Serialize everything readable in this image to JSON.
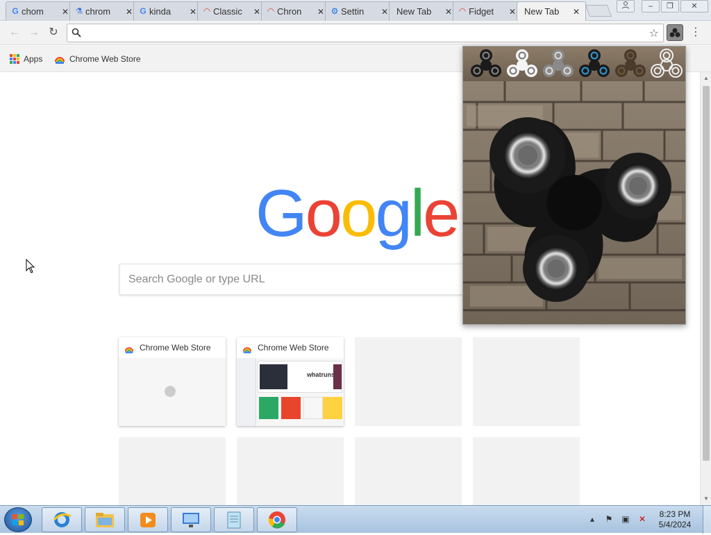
{
  "tabs": [
    {
      "label": "chom",
      "favicon": "google-icon",
      "active": false
    },
    {
      "label": "chrom",
      "favicon": "flask-icon",
      "active": false
    },
    {
      "label": "kinda",
      "favicon": "google-icon",
      "active": false
    },
    {
      "label": "Classic",
      "favicon": "rainbow-icon",
      "active": false
    },
    {
      "label": "Chron",
      "favicon": "rainbow-icon",
      "active": false
    },
    {
      "label": "Settin",
      "favicon": "gear-icon",
      "active": false
    },
    {
      "label": "New Tab",
      "favicon": "",
      "active": false
    },
    {
      "label": "Fidget",
      "favicon": "rainbow-icon",
      "active": false
    },
    {
      "label": "New Tab",
      "favicon": "",
      "active": true
    }
  ],
  "toolbar": {
    "omnibox_value": "",
    "omnibox_placeholder": ""
  },
  "bookmarks": {
    "apps_label": "Apps",
    "store_label": "Chrome Web Store"
  },
  "ntp": {
    "logo_letters": [
      "G",
      "o",
      "o",
      "g",
      "l",
      "e"
    ],
    "logo_colors": [
      "#4285f4",
      "#ea4335",
      "#fbbc05",
      "#4285f4",
      "#34a853",
      "#ea4335"
    ],
    "search_placeholder": "Search Google or type URL",
    "tiles": [
      {
        "title": "Chrome Web Store",
        "kind": "loading"
      },
      {
        "title": "Chrome Web Store",
        "kind": "thumbnail"
      },
      {
        "title": "",
        "kind": "empty"
      },
      {
        "title": "",
        "kind": "empty"
      },
      {
        "title": "",
        "kind": "empty"
      },
      {
        "title": "",
        "kind": "empty"
      },
      {
        "title": "",
        "kind": "empty"
      },
      {
        "title": "",
        "kind": "empty"
      }
    ],
    "thumbnail_text": "whatruns"
  },
  "popup": {
    "spinner_styles": [
      "black",
      "white",
      "gray",
      "blue",
      "brown",
      "outline"
    ]
  },
  "taskbar": {
    "apps": [
      "ie-icon",
      "explorer-icon",
      "media-player-icon",
      "network-icon",
      "notepad-icon",
      "chrome-icon"
    ],
    "time": "8:23 PM",
    "date": "5/4/2024"
  },
  "colors": {
    "accent": "#4285f4",
    "tab_active": "#f2f2f2",
    "taskbar": "#a8c3df"
  }
}
